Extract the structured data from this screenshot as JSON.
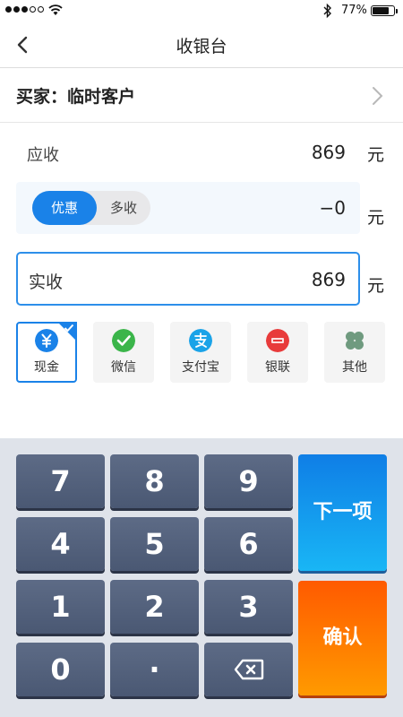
{
  "status_bar": {
    "battery_pct": "77%",
    "battery_level": 0.77
  },
  "nav": {
    "title": "收银台"
  },
  "buyer": {
    "text": "买家：临时客户"
  },
  "receivable": {
    "label": "应收",
    "amount": "869",
    "unit": "元"
  },
  "discount": {
    "toggle_on": "优惠",
    "toggle_off": "多收",
    "amount": "−0",
    "unit": "元"
  },
  "actual": {
    "label": "实收",
    "amount": "869",
    "unit": "元"
  },
  "payment_methods": [
    {
      "label": "现金",
      "icon": "cash-icon",
      "color": "#1a82e8",
      "selected": true
    },
    {
      "label": "微信",
      "icon": "wechat-icon",
      "color": "#3bb54a",
      "selected": false
    },
    {
      "label": "支付宝",
      "icon": "alipay-icon",
      "color": "#1aa3e8",
      "selected": false
    },
    {
      "label": "银联",
      "icon": "unionpay-icon",
      "color": "#e83b3b",
      "selected": false
    },
    {
      "label": "其他",
      "icon": "other-icon",
      "color": "#6f9a7f",
      "selected": false
    }
  ],
  "keypad": {
    "keys": [
      "7",
      "8",
      "9",
      "4",
      "5",
      "6",
      "1",
      "2",
      "3",
      "0",
      "·"
    ],
    "delete_icon": "backspace-icon",
    "next_label": "下一项",
    "confirm_label": "确认"
  },
  "colors": {
    "accent": "#1a82e8",
    "next": "#0f7ee6",
    "confirm": "#ff6a00",
    "key": "#4f5d78"
  }
}
